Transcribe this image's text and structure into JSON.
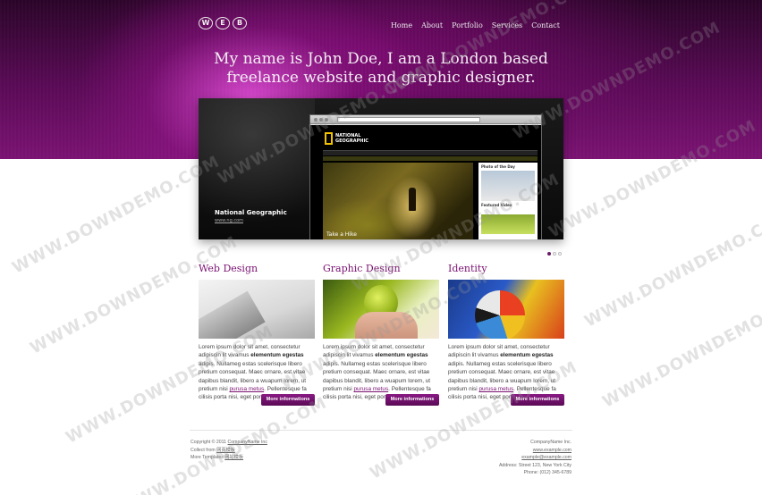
{
  "header": {
    "logo_letters": [
      "W",
      "E",
      "B"
    ],
    "nav": [
      "Home",
      "About",
      "Portfolio",
      "Services",
      "Contact"
    ],
    "headline_line1": "My name is John Doe, I am a London based",
    "headline_line2": "freelance website and graphic designer."
  },
  "slider": {
    "title": "National Geographic",
    "link": "www.ng.com",
    "inner": {
      "logo_text_1": "NATIONAL",
      "logo_text_2": "GEOGRAPHIC",
      "caption": "Take a Hike",
      "side_label_1": "Photo of the Day",
      "side_label_2": "Featured Video"
    },
    "pager_count": 3,
    "pager_active": 1
  },
  "columns": [
    {
      "title": "Web Design",
      "text_a": "Lorem ipsum dolor sit amet, consectetur adipiscin lit vivamus ",
      "bold": "elementum egestas",
      "text_b": " adipis. Nullameg estas scelerisque libero pretium consequat. Maec ornare, est vitae dapibus blandit, libero a wuapum lorem, ut pretium nisi ",
      "link": "purusa metus",
      "text_c": ". Pellentesque fa cilisis porta nisi, eget porta molestie ipsum.",
      "button": "More informations"
    },
    {
      "title": "Graphic Design",
      "text_a": "Lorem ipsum dolor sit amet, consectetur adipiscin lit vivamus ",
      "bold": "elementum egestas",
      "text_b": " adipis. Nullameg estas scelerisque libero pretium consequat. Maec ornare, est vitae dapibus blandit, libero a wuapum lorem, ut pretium nisi ",
      "link": "purusa metus",
      "text_c": ". Pellentesque fa cilisis porta nisi, eget porta molestie ipsum.",
      "button": "More informations"
    },
    {
      "title": "Identity",
      "text_a": "Lorem ipsum dolor sit amet, consectetur adipiscin lit vivamus ",
      "bold": "elementum egestas",
      "text_b": " adipis. Nullameg estas scelerisque libero pretium consequat. Maec ornare, est vitae dapibus blandit, libero a wuapum lorem, ut pretium nisi ",
      "link": "purusa metus",
      "text_c": ". Pellentesque fa cilisis porta nisi, eget porta molestie ipsum.",
      "button": "More informations"
    }
  ],
  "footer": {
    "copyright_prefix": "Copyright © 2011 ",
    "copyright_link": "CompanyName Inc",
    "line2_prefix": "Collect from ",
    "line2_link": "网页模板",
    "line3_prefix": "More Templates ",
    "line3_link": "网站模板",
    "company": "CompanyName Inc.",
    "website": "www.example.com",
    "email": "example@example.com",
    "address": "Address: Street 123, New York City",
    "phone": "Phone: (012) 345-6789"
  },
  "watermark": "WWW.DOWNDEMO.COM",
  "colors": {
    "brand": "#7a1272",
    "button": "#6a1268"
  }
}
